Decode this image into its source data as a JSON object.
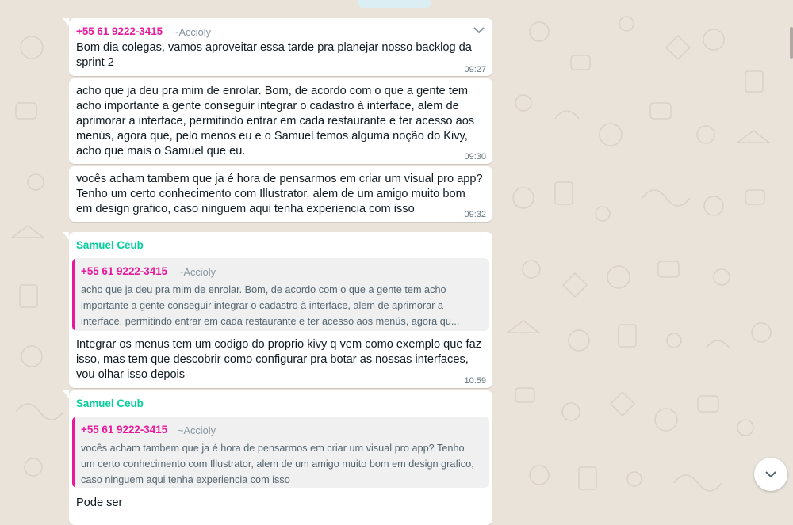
{
  "messages": [
    {
      "sender_phone": "+55 61 9222-3415",
      "sender_alias": "~Accioly",
      "text": "Bom dia colegas, vamos aproveitar essa tarde pra planejar nosso backlog da sprint 2",
      "time": "09:27"
    },
    {
      "text": "acho que ja deu pra mim de enrolar. Bom, de acordo com o que a gente tem acho importante a gente conseguir integrar o cadastro à interface, alem de aprimorar a interface, permitindo entrar em cada restaurante e ter acesso aos menús, agora que, pelo menos eu e o Samuel temos alguma noção do Kivy, acho que mais o Samuel que eu.",
      "time": "09:30"
    },
    {
      "text": "vocês acham tambem que ja é hora de pensarmos em criar um visual pro app? Tenho um certo conhecimento com Illustrator, alem de um amigo muito bom em design grafico, caso ninguem aqui tenha experiencia com isso",
      "time": "09:32"
    },
    {
      "sender_name": "Samuel Ceub",
      "quote": {
        "phone": "+55 61 9222-3415",
        "alias": "~Accioly",
        "text": "acho que ja deu pra mim de enrolar. Bom, de acordo com o que a gente tem acho importante a gente conseguir integrar o cadastro à interface, alem de aprimorar a interface, permitindo entrar em cada restaurante e ter acesso aos menús, agora qu..."
      },
      "text": "Integrar os menus tem um codigo do proprio kivy q vem como exemplo que faz isso, mas tem que descobrir como configurar pra botar as nossas interfaces, vou olhar isso depois",
      "time": "10:59"
    },
    {
      "sender_name": "Samuel Ceub",
      "quote": {
        "phone": "+55 61 9222-3415",
        "alias": "~Accioly",
        "text": "vocês acham tambem que ja é hora de pensarmos em criar um visual pro app? Tenho um certo conhecimento com Illustrator, alem de um amigo muito bom em design grafico, caso ninguem aqui tenha experiencia com isso"
      },
      "text": "Pode ser"
    }
  ],
  "icons": {
    "message_menu": "chevron-down-icon",
    "scroll_down": "chevron-down-icon"
  },
  "colors": {
    "wallpaper": "#e9e3da",
    "bubble": "#ffffff",
    "phone_sender": "#e8199d",
    "named_sender": "#06cf9c",
    "quote_background": "#f0f0f0"
  }
}
